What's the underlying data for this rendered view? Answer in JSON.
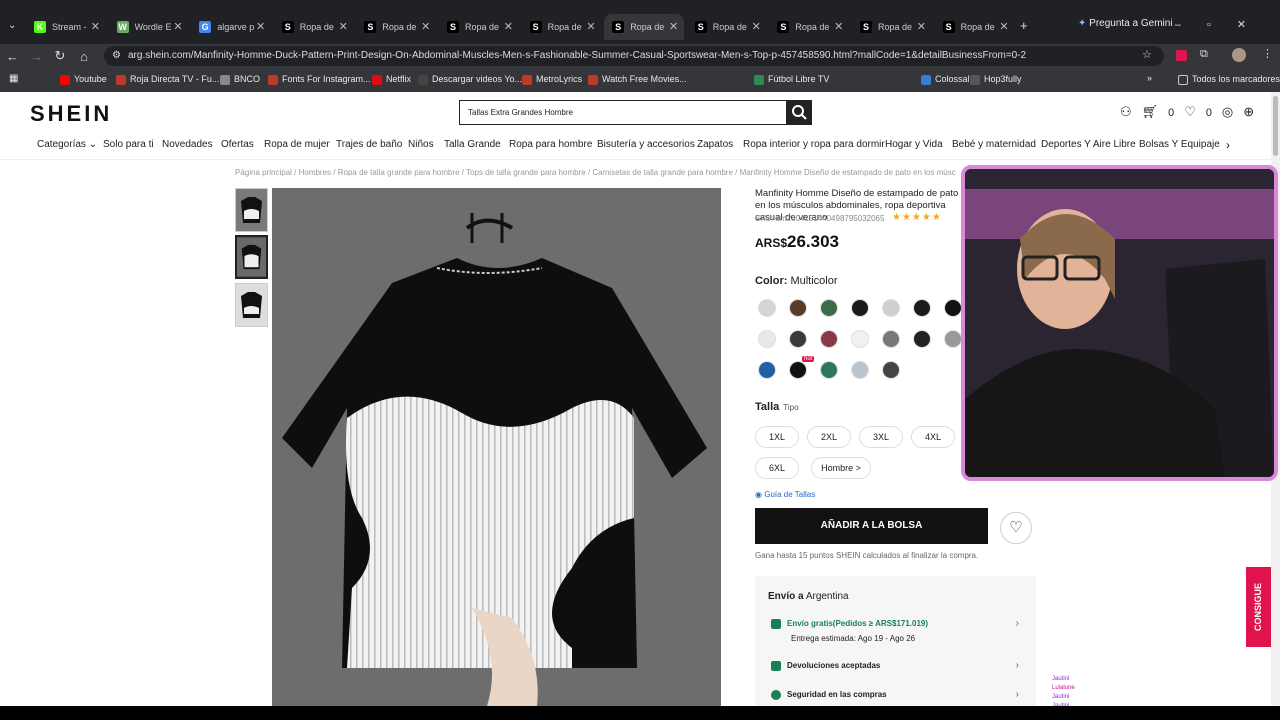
{
  "browser": {
    "tabs": [
      {
        "label": "Stream - ",
        "icon": "kick-icon",
        "color": "#53fc18",
        "glyph": "K"
      },
      {
        "label": "Wordle E",
        "icon": "wordle-icon",
        "color": "#6aaa64",
        "glyph": "W"
      },
      {
        "label": "algarve p",
        "icon": "google-icon",
        "color": "#4285f4",
        "glyph": "G"
      },
      {
        "label": "Ropa de",
        "icon": "shein-icon",
        "color": "#000000",
        "glyph": "S"
      },
      {
        "label": "Ropa de",
        "icon": "shein-icon",
        "color": "#000000",
        "glyph": "S"
      },
      {
        "label": "Ropa de",
        "icon": "shein-icon",
        "color": "#000000",
        "glyph": "S"
      },
      {
        "label": "Ropa de",
        "icon": "shein-icon",
        "color": "#000000",
        "glyph": "S"
      },
      {
        "label": "Ropa de",
        "icon": "shein-icon",
        "color": "#000000",
        "glyph": "S",
        "active": true
      },
      {
        "label": "Ropa de",
        "icon": "shein-icon",
        "color": "#000000",
        "glyph": "S"
      },
      {
        "label": "Ropa de",
        "icon": "shein-icon",
        "color": "#000000",
        "glyph": "S"
      },
      {
        "label": "Ropa de",
        "icon": "shein-icon",
        "color": "#000000",
        "glyph": "S"
      },
      {
        "label": "Ropa de",
        "icon": "shein-icon",
        "color": "#000000",
        "glyph": "S"
      }
    ],
    "gemini_label": "Pregunta a Gemini",
    "url": "arg.shein.com/Manfinity-Homme-Duck-Pattern-Print-Design-On-Abdominal-Muscles-Men-s-Fashionable-Summer-Casual-Sportswear-Men-s-Top-p-457458590.html?mallCode=1&detailBusinessFrom=0-2",
    "bookmarks": [
      "Youtube",
      "Roja Directa TV - Fu...",
      "BNCO",
      "Fonts For Instagram...",
      "Netflix",
      "Descargar videos Yo...",
      "MetroLyrics",
      "Watch Free Movies...",
      "Fútbol Libre TV",
      "Colossal",
      "Hop3fully"
    ],
    "all_bookmarks": "Todos los marcadores"
  },
  "header": {
    "logo": "SHEIN",
    "search_value": "Tallas Extra Grandes Hombre",
    "cart_count": "0",
    "wish_count": "0"
  },
  "nav": [
    "Categorías",
    "Solo para ti",
    "Novedades",
    "Ofertas",
    "Ropa de mujer",
    "Trajes de baño",
    "Niños",
    "Talla Grande",
    "Ropa para hombre",
    "Bisutería y accesorios",
    "Zapatos",
    "Ropa interior y ropa para dormir",
    "Hogar y Vida",
    "Bebé y maternidad",
    "Deportes Y Aire Libre",
    "Bolsas Y Equipaje"
  ],
  "breadcrumb": "Página principal / Hombres / Ropa de talla grande para hombre / Tops de talla grande para hombre / Camisetas de talla grande para hombre / Manfinity Homme Diseño de estampado de pato en los músc",
  "product": {
    "title": "Manfinity Homme Diseño de estampado de pato en los músculos abdominales, ropa deportiva casual de verano",
    "sku": "SKU: sm2604151440498795032065",
    "price_currency": "ARS$",
    "price_value": "26.303",
    "color_label": "Color:",
    "color_value": "Multicolor",
    "size_label": "Talla",
    "size_type": "Tipo",
    "sizes": [
      "1XL",
      "2XL",
      "3XL",
      "4XL",
      "6XL",
      "Hombre >"
    ],
    "size_guide": "Guía de Tallas",
    "add_to_bag": "AÑADIR A LA BOLSA",
    "points": "Gana hasta 15 puntos SHEIN calculados al finalizar la compra.",
    "hot_badge": "hot"
  },
  "shipping": {
    "title_prefix": "Envío a",
    "country": "Argentina",
    "free_ship": "Envío gratis(Pedidos ≥ ARS$171.019)",
    "estimate": "Entrega estimada: Ago 19 - Ago 26",
    "returns": "Devoluciones aceptadas",
    "security": "Seguridad en las compras"
  },
  "promo_tab": "CONSIGUE",
  "chat": [
    "Jautini",
    "Lulalune",
    "Jautini",
    "Jautini"
  ],
  "colors": {
    "swatches": [
      "#d8d4cf",
      "#5a3b2a",
      "#3c6b47",
      "#1a1a1a",
      "#cfcfcf",
      "#1a1a1a",
      "#111111",
      "#e8e8e8",
      "#3a3a3a",
      "#8a3a45",
      "#f0f0f0",
      "#777777",
      "#222222",
      "#999999",
      "#1f5fa8",
      "#111111",
      "#2a7a5a",
      "#b8c4d0",
      "#444444"
    ],
    "accent": "#198055",
    "promo": "#e0144c"
  }
}
